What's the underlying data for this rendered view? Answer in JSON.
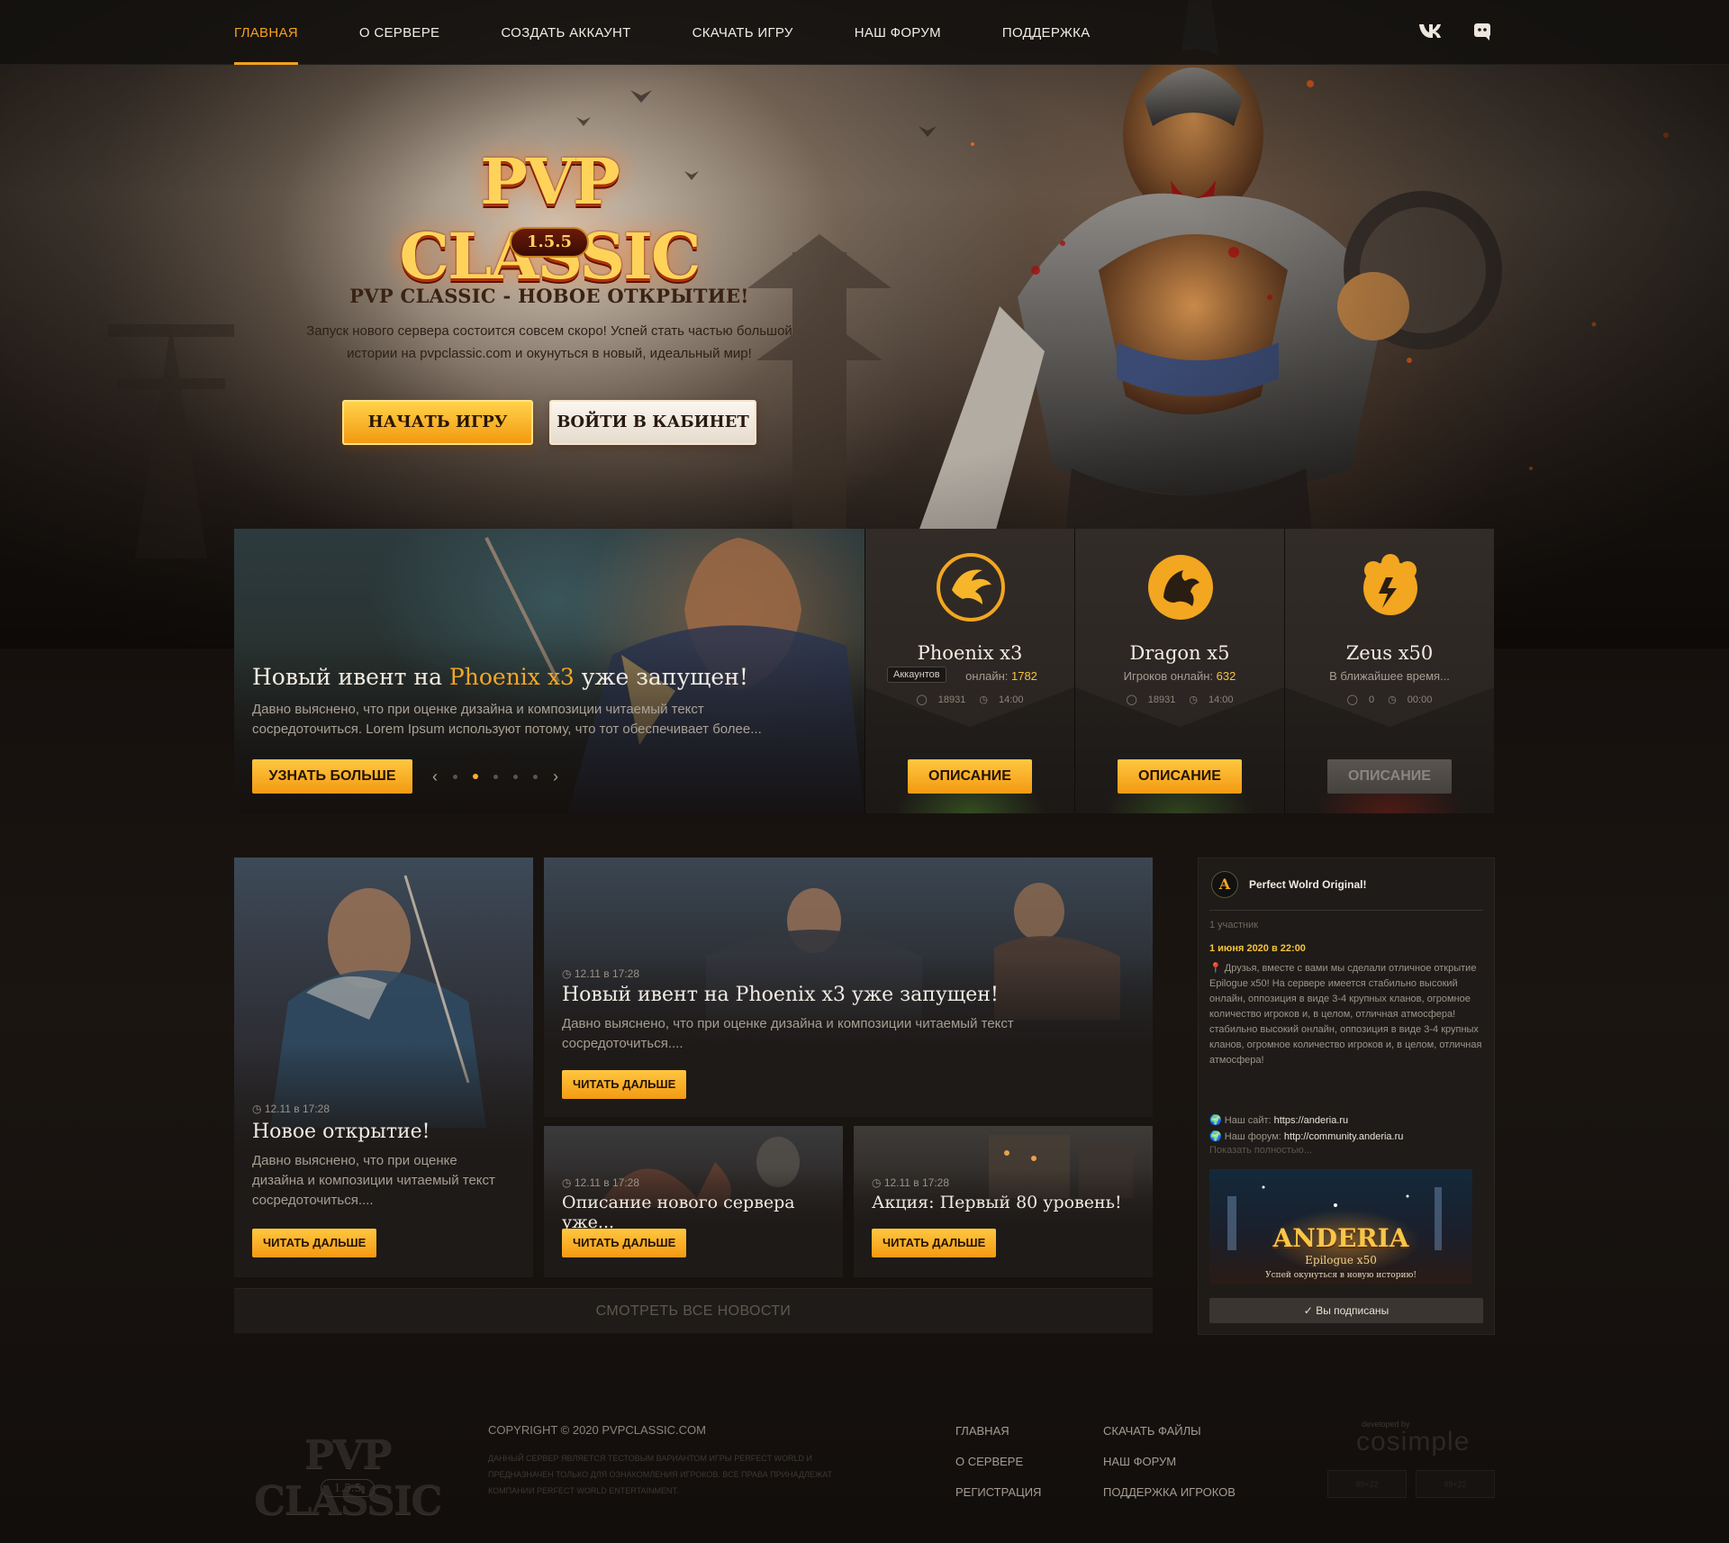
{
  "nav": {
    "items": [
      "ГЛАВНАЯ",
      "О СЕРВЕРЕ",
      "СОЗДАТЬ АККАУНТ",
      "СКАЧАТЬ ИГРУ",
      "НАШ ФОРУМ",
      "ПОДДЕРЖКА"
    ],
    "active": "ГЛАВНАЯ",
    "social": [
      "vk-icon",
      "discord-icon"
    ]
  },
  "hero": {
    "logo_text": "PVP CLASSIC",
    "logo_version": "1.5.5",
    "title": "PVP CLASSIC - НОВОЕ ОТКРЫТИЕ!",
    "subtitle_line1": "Запуск нового сервера состоится совсем скоро! Успей стать частью большой",
    "subtitle_line2": "истории на pvpclassic.com и окунуться в новый, идеальный мир!",
    "btn_start": "НАЧАТЬ ИГРУ",
    "btn_cabinet": "ВОЙТИ В КАБИНЕТ"
  },
  "slider": {
    "title_before": "Новый ивент на ",
    "title_highlight": "Phoenix x3",
    "title_after": " уже запущен!",
    "text": "Давно выяснено, что при оценке дизайна и композиции читаемый текст сосредоточиться. Lorem Ipsum используют потому, что тот обеспечивает более...",
    "btn": "УЗНАТЬ БОЛЬШЕ",
    "dots": 6,
    "active_dot": 2
  },
  "servers": [
    {
      "name": "Phoenix x3",
      "online_label": "онлайн: ",
      "online_value": "1782",
      "accounts": "18931",
      "time": "14:00",
      "tooltip": "Аккаунтов",
      "btn": "ОПИСАНИЕ",
      "status": "active",
      "emblem": "phoenix-emblem-icon"
    },
    {
      "name": "Dragon x5",
      "online_label": "Игроков онлайн: ",
      "online_value": "632",
      "accounts": "18931",
      "time": "14:00",
      "btn": "ОПИСАНИЕ",
      "status": "active",
      "emblem": "dragon-emblem-icon"
    },
    {
      "name": "Zeus x50",
      "online_label": "В ближайшее время...",
      "online_value": "",
      "accounts": "0",
      "time": "00:00",
      "btn": "ОПИСАНИЕ",
      "status": "disabled",
      "emblem": "zeus-emblem-icon"
    }
  ],
  "news": {
    "big": {
      "date": "12.11 в 17:28",
      "title": "Новое открытие!",
      "text": "Давно выяснено, что при оценке дизайна и композиции читаемый текст сосредоточиться....",
      "btn": "ЧИТАТЬ ДАЛЬШЕ"
    },
    "wide": {
      "date": "12.11 в 17:28",
      "title": "Новый ивент на Phoenix x3 уже запущен!",
      "text": "Давно выяснено, что при оценке дизайна и композиции читаемый текст сосредоточиться....",
      "btn": "ЧИТАТЬ ДАЛЬШЕ"
    },
    "small1": {
      "date": "12.11 в 17:28",
      "title": "Описание нового сервера уже...",
      "btn": "ЧИТАТЬ ДАЛЬШЕ"
    },
    "small2": {
      "date": "12.11 в 17:28",
      "title": "Акция: Первый 80 уровень!",
      "btn": "ЧИТАТЬ ДАЛЬШЕ"
    },
    "all": "СМОТРЕТЬ ВСЕ НОВОСТИ"
  },
  "widget": {
    "avatar_letter": "A",
    "group": "Perfect Wolrd Original!",
    "members": "1 участник",
    "date": "1 июня 2020 в 22:00",
    "post_icon": "📍",
    "post": "Друзья, вместе с вами мы сделали отличное открытие Epilogue x50! На сервере имеется стабильно высокий онлайн, оппозиция в виде 3-4 крупных кланов, огромное количество игроков и, в целом, отличная атмосфера! стабильно высокий онлайн, оппозиция в виде 3-4 крупных кланов, огромное количество игроков и, в целом, отличная атмосфера!",
    "site_label": "Наш сайт: ",
    "site_url": "https://anderia.ru",
    "forum_label": "Наш форум: ",
    "forum_url": "http://community.anderia.ru",
    "more": "Показать полностью...",
    "image_title": "ANDERIA",
    "image_sub": "Epilogue x50",
    "image_tag": "Успей окунуться в новую историю!",
    "subscribed": "Вы подписаны"
  },
  "footer": {
    "logo_text": "PVP CLASSIC",
    "logo_version": "1.5.5",
    "copyright": "COPYRIGHT © 2020 PVPCLASSIC.COM",
    "legal": "Данный сервер является тестовым вариантом игры Perfect World и предназначен только для ознакомления игроков. Все права принадлежат компании Perfect World Entertainment.",
    "col1": [
      "ГЛАВНАЯ",
      "О СЕРВЕРЕ",
      "РЕГИСТРАЦИЯ"
    ],
    "col2": [
      "СКАЧАТЬ ФАЙЛЫ",
      "НАШ ФОРУМ",
      "ПОДДЕРЖКА ИГРОКОВ"
    ],
    "dev_small": "developed by",
    "dev": "cosimple",
    "counters": [
      "99+22",
      "99+22"
    ]
  },
  "colors": {
    "accent": "#f5a623",
    "button_top": "#ffc740",
    "button_bottom": "#f39a12",
    "panel": "#1f1b18",
    "bg": "#15100d"
  }
}
